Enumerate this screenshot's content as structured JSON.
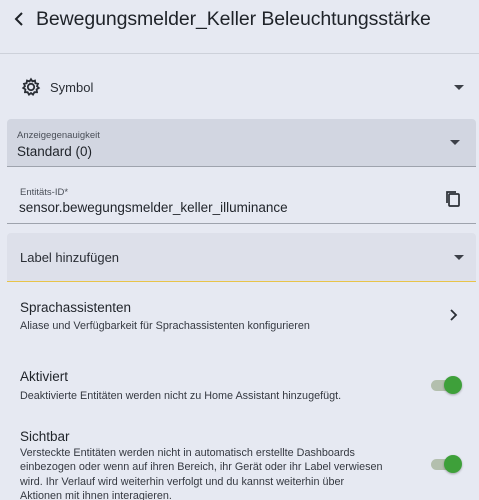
{
  "header": {
    "title": "Bewegungsmelder_Keller Beleuchtungsstärke"
  },
  "icon_row": {
    "label": "Symbol"
  },
  "display_precision": {
    "label": "Anzeigegenauigkeit",
    "value": "Standard (0)"
  },
  "entity_id": {
    "label": "Entitäts-ID*",
    "value": "sensor.bewegungsmelder_keller_illuminance"
  },
  "labels": {
    "placeholder": "Label hinzufügen"
  },
  "voice_assistants": {
    "title": "Sprachassistenten",
    "description": "Aliase und Verfügbarkeit für Sprachassistenten konfigurieren"
  },
  "enabled": {
    "title": "Aktiviert",
    "description": "Deaktivierte Entitäten werden nicht zu Home Assistant hinzugefügt.",
    "on": true
  },
  "visible": {
    "title": "Sichtbar",
    "description_lines": [
      "Versteckte Entitäten werden nicht in automatisch erstellte Dashboards",
      "einbezogen oder wenn auf ihren Bereich, ihr Gerät oder ihr Label verwiesen",
      "wird. Ihr Verlauf wird weiterhin verfolgt und du kannst weiterhin über",
      "Aktionen mit ihnen interagieren."
    ],
    "on": true
  },
  "colors": {
    "background": "#e6e9f2",
    "toggle_on": "#3ea03a",
    "focus_underline": "#e8c44a"
  }
}
